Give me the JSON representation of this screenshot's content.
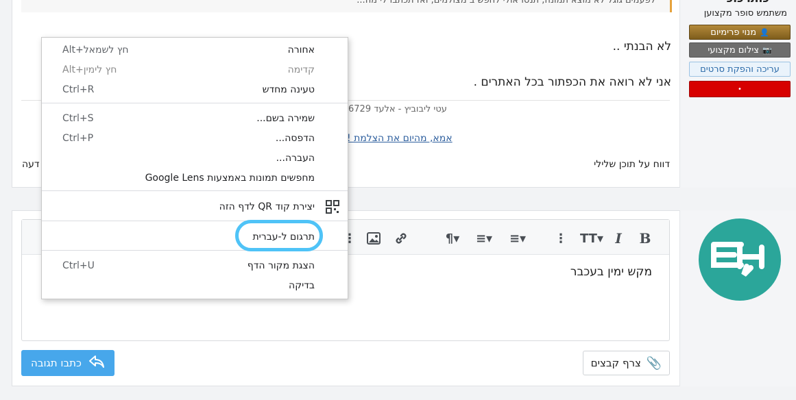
{
  "sidebar": {
    "username_partial": "כותרכוכ",
    "rank": "משתמש סופר מקצוען",
    "badges": {
      "premium": "מנוי פרימיום",
      "photo": "צילום מקצועי",
      "editing": "עריכה והפקת סרטים",
      "red": "•"
    }
  },
  "post": {
    "quote_partial": "לפעמים גוגל לא מוצא תמונה, תנסו אולי לחפש ב מצולמים, ואז תכתבו לי מה...",
    "line1": "לא הבנתי ..",
    "line2": "אני לא רואה את הכפתור בכל האתרים .",
    "signature_meta": "עטי ליבוביץ - אלעד 6729",
    "signature_link": "אמא, מהיום את הצלמת ! ",
    "report_label": "דווח על תוכן שלילי",
    "cut_label": "דעה"
  },
  "context_menu": {
    "items": [
      {
        "label": "אחורה",
        "shortcut": "Alt+חץ לשמאל"
      },
      {
        "label": "קדימה",
        "shortcut": "Alt+חץ לימין"
      },
      {
        "label": "טעינה מחדש",
        "shortcut": "Ctrl+R"
      },
      {
        "label": "שמירה בשם...",
        "shortcut": "Ctrl+S"
      },
      {
        "label": "הדפסה...",
        "shortcut": "Ctrl+P"
      },
      {
        "label": "העברה...",
        "shortcut": ""
      },
      {
        "label": "מחפשים תמונות באמצעות Google Lens",
        "shortcut": ""
      },
      {
        "label": "יצירת קוד QR לדף הזה",
        "shortcut": ""
      },
      {
        "label": "תרגום ל-עברית",
        "shortcut": ""
      },
      {
        "label": "הצגת מקור הדף",
        "shortcut": "Ctrl+U"
      },
      {
        "label": "בדיקה",
        "shortcut": ""
      }
    ]
  },
  "editor": {
    "text": "מקש ימין בעכבר",
    "attach_label": "צרף קבצים",
    "reply_label": "כתבו תגובה"
  },
  "colors": {
    "highlight_circle": "#4fc3f7",
    "reply_button": "#47a7eb",
    "avatar_bg": "#2ba69a"
  }
}
